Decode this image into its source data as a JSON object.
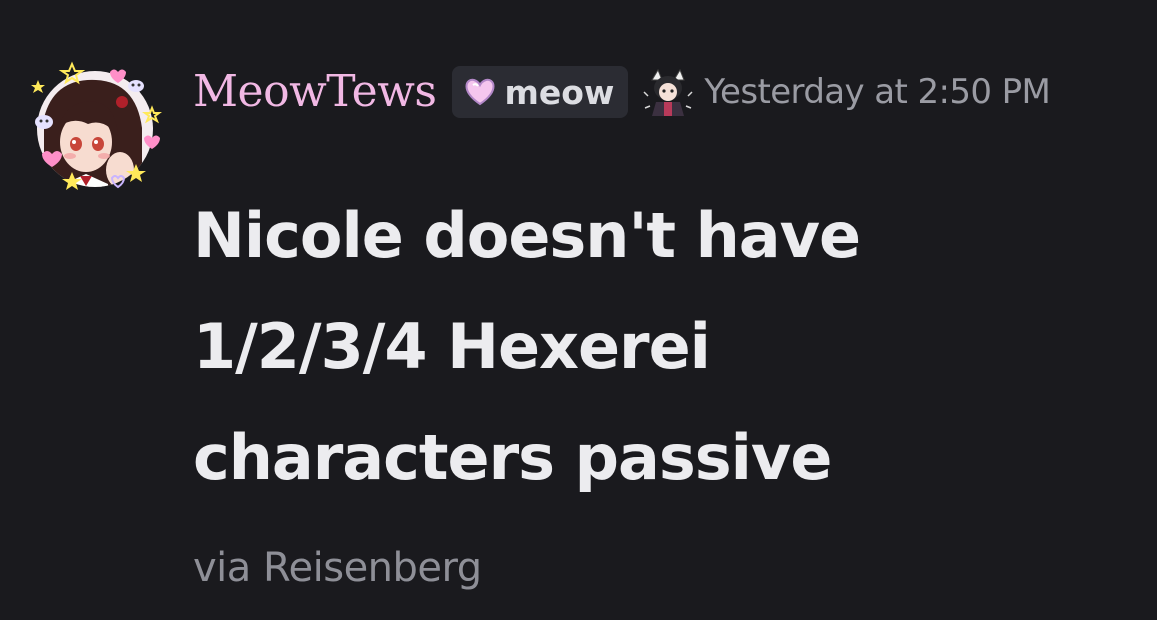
{
  "message": {
    "author": {
      "username": "MeowTews",
      "username_color": "#f1b8e4",
      "avatar_icon": "anime-girl-avatar-with-stars-and-hearts",
      "tag": {
        "icon": "pink-heart-icon",
        "label": "meow"
      },
      "role_icon": "anime-character-role-icon"
    },
    "timestamp": "Yesterday at 2:50 PM",
    "content_lines": [
      "Nicole doesn't have",
      "1/2/3/4 Hexerei",
      "characters passive"
    ],
    "subtext": "via Reisenberg"
  },
  "colors": {
    "background": "#1a1a1e",
    "content_text": "#ececef",
    "muted_text": "#9a9ba3",
    "tag_background": "#2b2c33"
  }
}
